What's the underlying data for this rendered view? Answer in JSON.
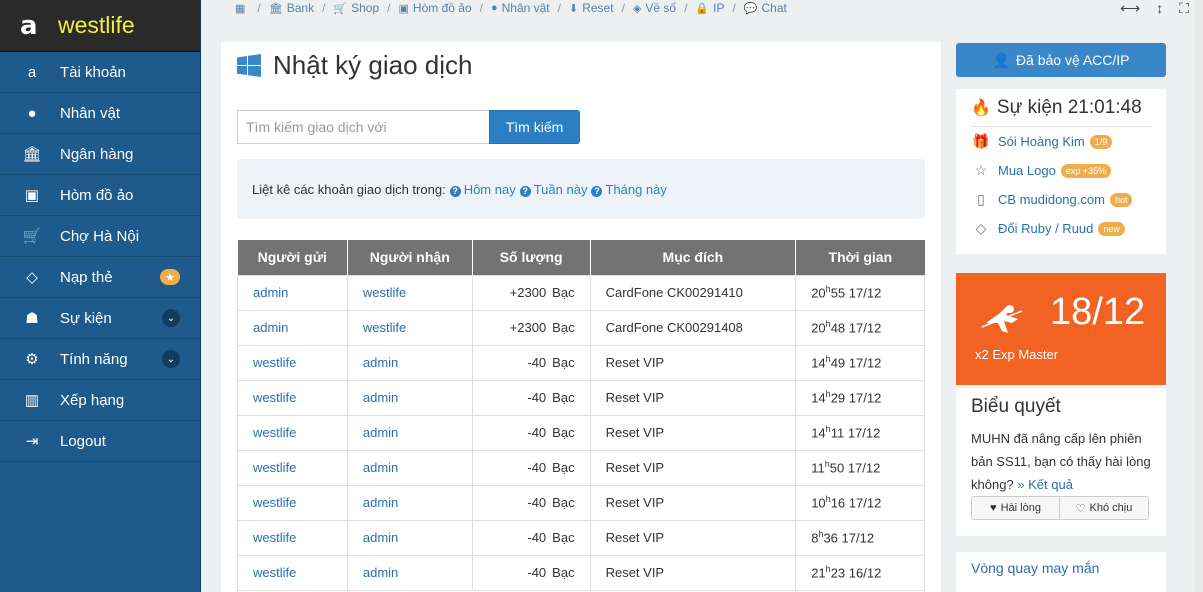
{
  "brand": {
    "name": "westlife",
    "logo_char": "a"
  },
  "sidebar": {
    "items": [
      {
        "label": "Tài khoản",
        "icon": "amazon-icon"
      },
      {
        "label": "Nhân vật",
        "icon": "user-icon"
      },
      {
        "label": "Ngân hàng",
        "icon": "bank-icon"
      },
      {
        "label": "Hòm đồ ảo",
        "icon": "briefcase-icon"
      },
      {
        "label": "Chợ Hà Nội",
        "icon": "cart-icon"
      },
      {
        "label": "Nạp thẻ",
        "icon": "diamond-icon",
        "badge": "★"
      },
      {
        "label": "Sự kiện",
        "icon": "android-icon",
        "chevron": "⌄"
      },
      {
        "label": "Tính năng",
        "icon": "gears-icon",
        "chevron": "⌄"
      },
      {
        "label": "Xếp hạng",
        "icon": "chart-icon"
      },
      {
        "label": "Logout",
        "icon": "logout-icon"
      }
    ]
  },
  "topnav": {
    "links": [
      "Bank",
      "Shop",
      "Hòm đồ ảo",
      "Nhân vật",
      "Reset",
      "Về số",
      "IP",
      "Chat"
    ]
  },
  "main": {
    "title": "Nhật ký giao dịch",
    "search_placeholder": "Tìm kiếm giao dịch với",
    "search_button": "Tìm kiếm",
    "filter_label": "Liệt kê các khoản giao dịch trong:",
    "filters": [
      "Hôm nay",
      "Tuần này",
      "Tháng này"
    ],
    "table": {
      "headers": [
        "Người gửi",
        "Người nhận",
        "Số lượng",
        "Mục đích",
        "Thời gian"
      ],
      "rows": [
        {
          "sender": "admin",
          "receiver": "westlife",
          "amount": "+2300",
          "unit": "Bạc",
          "purpose": "CardFone CK00291410",
          "hour": "20",
          "minute": "55",
          "date": "17/12"
        },
        {
          "sender": "admin",
          "receiver": "westlife",
          "amount": "+2300",
          "unit": "Bạc",
          "purpose": "CardFone CK00291408",
          "hour": "20",
          "minute": "48",
          "date": "17/12"
        },
        {
          "sender": "westlife",
          "receiver": "admin",
          "amount": "-40",
          "unit": "Bạc",
          "purpose": "Reset VIP",
          "hour": "14",
          "minute": "49",
          "date": "17/12"
        },
        {
          "sender": "westlife",
          "receiver": "admin",
          "amount": "-40",
          "unit": "Bạc",
          "purpose": "Reset VIP",
          "hour": "14",
          "minute": "29",
          "date": "17/12"
        },
        {
          "sender": "westlife",
          "receiver": "admin",
          "amount": "-40",
          "unit": "Bạc",
          "purpose": "Reset VIP",
          "hour": "14",
          "minute": "11",
          "date": "17/12"
        },
        {
          "sender": "westlife",
          "receiver": "admin",
          "amount": "-40",
          "unit": "Bạc",
          "purpose": "Reset VIP",
          "hour": "11",
          "minute": "50",
          "date": "17/12"
        },
        {
          "sender": "westlife",
          "receiver": "admin",
          "amount": "-40",
          "unit": "Bạc",
          "purpose": "Reset VIP",
          "hour": "10",
          "minute": "16",
          "date": "17/12"
        },
        {
          "sender": "westlife",
          "receiver": "admin",
          "amount": "-40",
          "unit": "Bạc",
          "purpose": "Reset VIP",
          "hour": "8",
          "minute": "36",
          "date": "17/12"
        },
        {
          "sender": "westlife",
          "receiver": "admin",
          "amount": "-40",
          "unit": "Bạc",
          "purpose": "Reset VIP",
          "hour": "21",
          "minute": "23",
          "date": "16/12"
        }
      ]
    }
  },
  "right": {
    "protect_button": "Đã bảo vệ ACC/IP",
    "event_title": "Sự kiện 21:01:48",
    "events": [
      {
        "label": "Sói Hoàng Kim",
        "tag": "1/9",
        "icon": "gift-icon"
      },
      {
        "label": "Mua Logo",
        "tag": "exp +35%",
        "icon": "star-icon"
      },
      {
        "label": "CB mudidong.com",
        "tag": "hot",
        "icon": "mobile-icon"
      },
      {
        "label": "Đổi Ruby / Ruud",
        "tag": "new",
        "icon": "diamond-icon"
      }
    ],
    "promo": {
      "big": "18/12",
      "sub": "x2 Exp Master"
    },
    "poll": {
      "title": "Biểu quyết",
      "body": "MUHN đã nâng cấp lên phiên bản SS11, bạn có thấy hài lòng không?",
      "more": "» Kết quả",
      "yes": "Hài lòng",
      "no": "Khó chịu"
    },
    "lucky_title": "Vòng quay may mắn"
  },
  "colors": {
    "sidebar": "#1e5b8c",
    "accent": "#2d7fc4",
    "promo": "#f26222",
    "badge": "#f0ad4e"
  }
}
